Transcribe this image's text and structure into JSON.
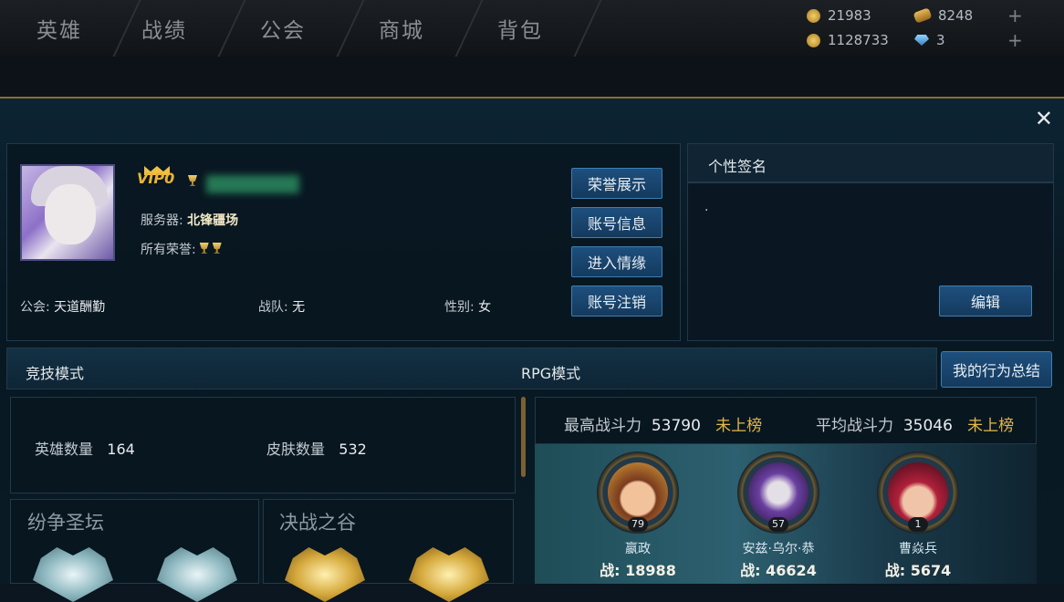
{
  "nav": {
    "tabs": [
      "英雄",
      "战绩",
      "公会",
      "商城",
      "背包"
    ]
  },
  "resources": {
    "gold": "21983",
    "ingot": "8248",
    "coupon": "1128733",
    "diamond": "3"
  },
  "profile": {
    "vip": "VIP0",
    "server_label": "服务器:",
    "server": "北锋疆场",
    "honors_label": "所有荣誉:",
    "guild_label": "公会:",
    "guild": "天道酬勤",
    "team_label": "战队:",
    "team": "无",
    "gender_label": "性别:",
    "gender": "女"
  },
  "actions": [
    "荣誉展示",
    "账号信息",
    "进入情缘",
    "账号注销"
  ],
  "signature": {
    "title": "个性签名",
    "text": ".",
    "edit": "编辑"
  },
  "modes": {
    "competitive": "竞技模式",
    "rpg": "RPG模式",
    "summary": "我的行为总结"
  },
  "stats": {
    "hero_label": "英雄数量",
    "hero_count": "164",
    "skin_label": "皮肤数量",
    "skin_count": "532"
  },
  "areas": {
    "left": "纷争圣坛",
    "right": "决战之谷"
  },
  "power": {
    "max_label": "最高战斗力",
    "max": "53790",
    "max_rank": "未上榜",
    "avg_label": "平均战斗力",
    "avg": "35046",
    "avg_rank": "未上榜"
  },
  "heroes": [
    {
      "name": "嬴政",
      "level": "79",
      "power_label": "战:",
      "power": "18988"
    },
    {
      "name": "安兹·乌尔·恭",
      "level": "57",
      "power_label": "战:",
      "power": "46624"
    },
    {
      "name": "曹焱兵",
      "level": "1",
      "power_label": "战:",
      "power": "5674"
    }
  ],
  "colors": {
    "accent": "#e9b23a",
    "button": "#1e4f7d",
    "rank_text": "#e3b84a"
  }
}
